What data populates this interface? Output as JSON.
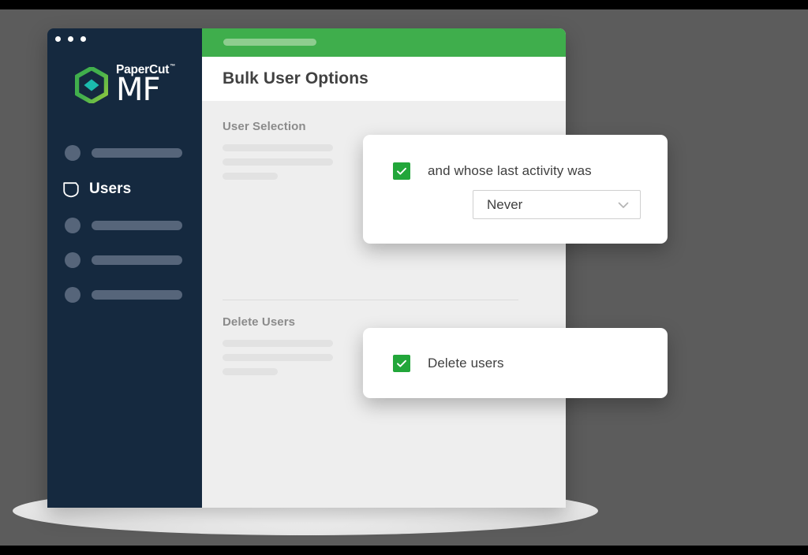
{
  "app": {
    "brand_primary": "PaperCut",
    "brand_trademark": "™",
    "brand_product": "MF",
    "sidebar_bg": "#15293f",
    "accent_green": "#3aaa35",
    "header_green": "#3fae4c",
    "checkbox_green": "#22a63a"
  },
  "titlebar": {
    "dots": [
      "window-dot",
      "window-dot",
      "window-dot"
    ]
  },
  "sidebar": {
    "items": [
      {
        "label": "",
        "icon": "bullet-icon",
        "placeholder": true,
        "active": false
      },
      {
        "label": "Users",
        "icon": "shield-icon",
        "placeholder": false,
        "active": false
      },
      {
        "label": "",
        "icon": "bullet-icon",
        "placeholder": true,
        "active": false
      },
      {
        "label": "",
        "icon": "bullet-icon",
        "placeholder": true,
        "active": true
      },
      {
        "label": "",
        "icon": "bullet-icon",
        "placeholder": true,
        "active": false
      }
    ]
  },
  "header": {
    "title": "Bulk User Options"
  },
  "main": {
    "sections": [
      {
        "title": "User Selection",
        "skeleton_lines": [
          "long",
          "long",
          "short"
        ]
      },
      {
        "title": "Delete Users",
        "skeleton_lines": [
          "long",
          "long",
          "short"
        ]
      }
    ]
  },
  "popups": {
    "activity": {
      "checkbox_label": "and whose last activity was",
      "checkbox_checked": true,
      "checkbox_icon": "check-icon",
      "select": {
        "value": "Never",
        "chevron_icon": "chevron-down-icon"
      }
    },
    "delete": {
      "checkbox_label": "Delete users",
      "checkbox_checked": true,
      "checkbox_icon": "check-icon"
    }
  }
}
